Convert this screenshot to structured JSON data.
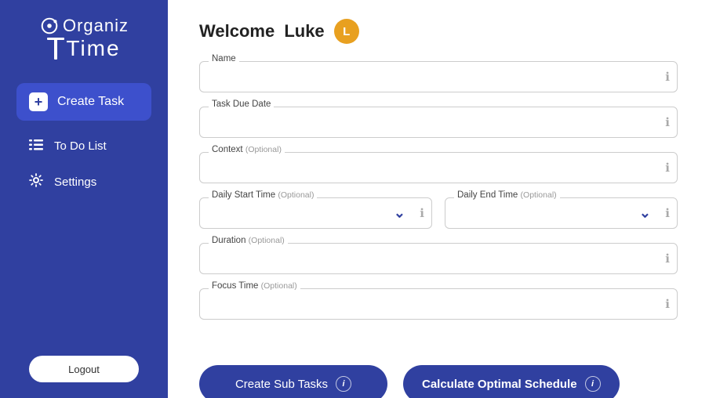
{
  "sidebar": {
    "logo_organiz": "Organiz",
    "logo_time": "Time",
    "nav": {
      "create_task_label": "Create Task",
      "todo_list_label": "To Do List",
      "settings_label": "Settings",
      "logout_label": "Logout"
    }
  },
  "header": {
    "welcome_prefix": "Welcome",
    "username": "Luke",
    "avatar_letter": "L"
  },
  "form": {
    "name_label": "Name",
    "due_date_label": "Task Due Date",
    "context_label": "Context",
    "context_optional": "(Optional)",
    "daily_start_label": "Daily Start Time",
    "daily_start_optional": "(Optional)",
    "daily_end_label": "Daily End Time",
    "daily_end_optional": "(Optional)",
    "duration_label": "Duration",
    "duration_optional": "(Optional)",
    "focus_time_label": "Focus Time",
    "focus_time_optional": "(Optional)"
  },
  "buttons": {
    "create_sub_tasks": "Create Sub Tasks",
    "calculate_schedule": "Calculate Optimal Schedule"
  },
  "icons": {
    "info": "ℹ",
    "chevron_down": "⌄",
    "plus": "+",
    "list_icon": "≡",
    "gear_icon": "⚙"
  },
  "colors": {
    "sidebar_bg": "#3040a0",
    "active_nav": "#3d50cc",
    "avatar_bg": "#e8a020",
    "button_bg": "#3040a0",
    "accent": "#3040a0"
  }
}
